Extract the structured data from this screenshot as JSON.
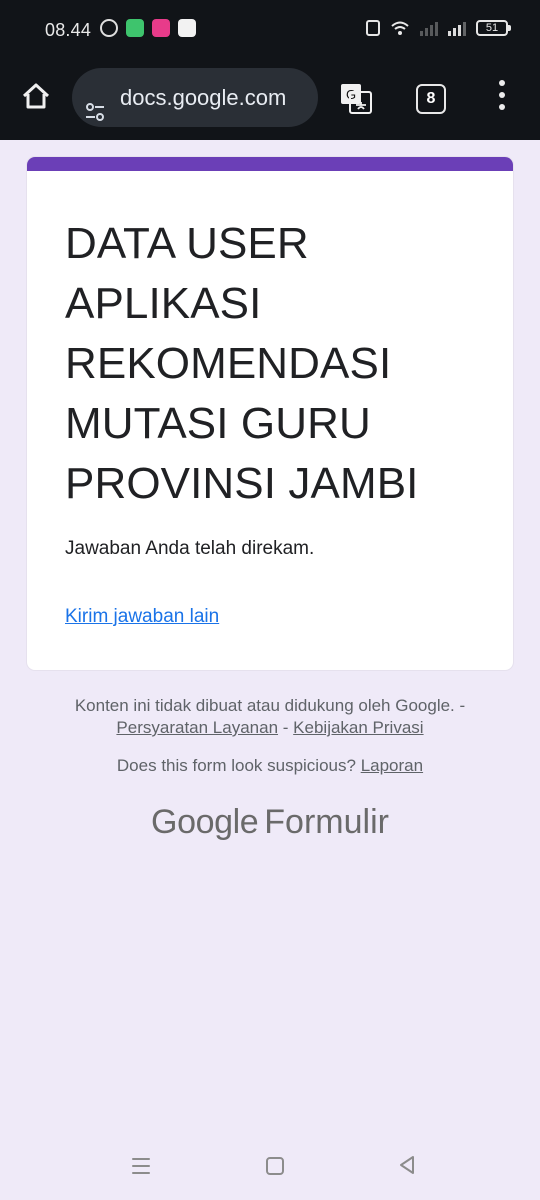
{
  "status_bar": {
    "time": "08.44",
    "battery": "51"
  },
  "browser": {
    "url": "docs.google.com",
    "tab_count": "8"
  },
  "form": {
    "title": "DATA USER APLIKASI REKOMENDASI MUTASI GURU PROVINSI JAMBI",
    "confirmation": "Jawaban Anda telah direkam.",
    "submit_another": "Kirim jawaban lain",
    "accent_color": "#6b3fb7"
  },
  "footer": {
    "disclaimer": "Konten ini tidak dibuat atau didukung oleh Google. -",
    "terms": "Persyaratan Layanan",
    "separator": "-",
    "privacy": "Kebijakan Privasi",
    "suspicious": "Does this form look suspicious?",
    "report": "Laporan",
    "brand_google": "Google",
    "brand_forms": "Formulir"
  }
}
